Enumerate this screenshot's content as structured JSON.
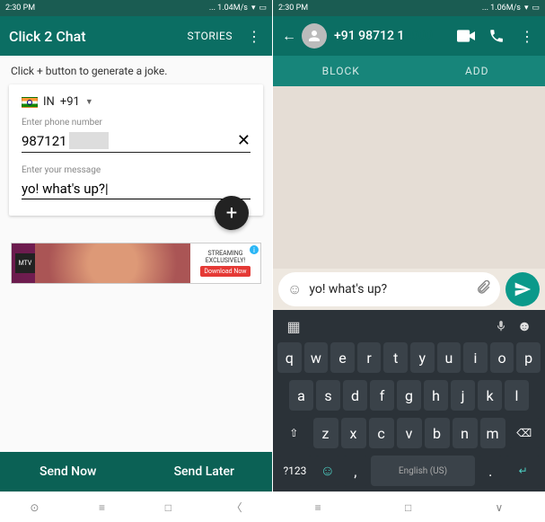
{
  "left": {
    "status": {
      "time": "2:30 PM",
      "speed": "... 1.04M/s"
    },
    "appbar": {
      "title": "Click 2 Chat",
      "action": "STORIES"
    },
    "hint": "Click + button to generate a joke.",
    "country": {
      "code": "IN",
      "dial": "+91"
    },
    "phone_label": "Enter phone number",
    "phone_visible": "987121",
    "msg_label": "Enter your message",
    "msg_value": "yo! what's up?",
    "ad": {
      "line1": "STREAMING",
      "line2": "EXCLUSIVELY!",
      "btn": "Download Now"
    },
    "bottom": {
      "now": "Send Now",
      "later": "Send Later"
    }
  },
  "right": {
    "status": {
      "time": "2:30 PM",
      "speed": "... 1.06M/s"
    },
    "contact": "+91 98712 1",
    "subbar": {
      "block": "BLOCK",
      "add": "ADD"
    },
    "composer_text": "yo! what's up?",
    "keyboard": {
      "row1": [
        "q",
        "w",
        "e",
        "r",
        "t",
        "y",
        "u",
        "i",
        "o",
        "p"
      ],
      "row2": [
        "a",
        "s",
        "d",
        "f",
        "g",
        "h",
        "j",
        "k",
        "l"
      ],
      "row3": [
        "z",
        "x",
        "c",
        "v",
        "b",
        "n",
        "m"
      ],
      "numkey": "?123",
      "lang": "English (US)"
    }
  }
}
